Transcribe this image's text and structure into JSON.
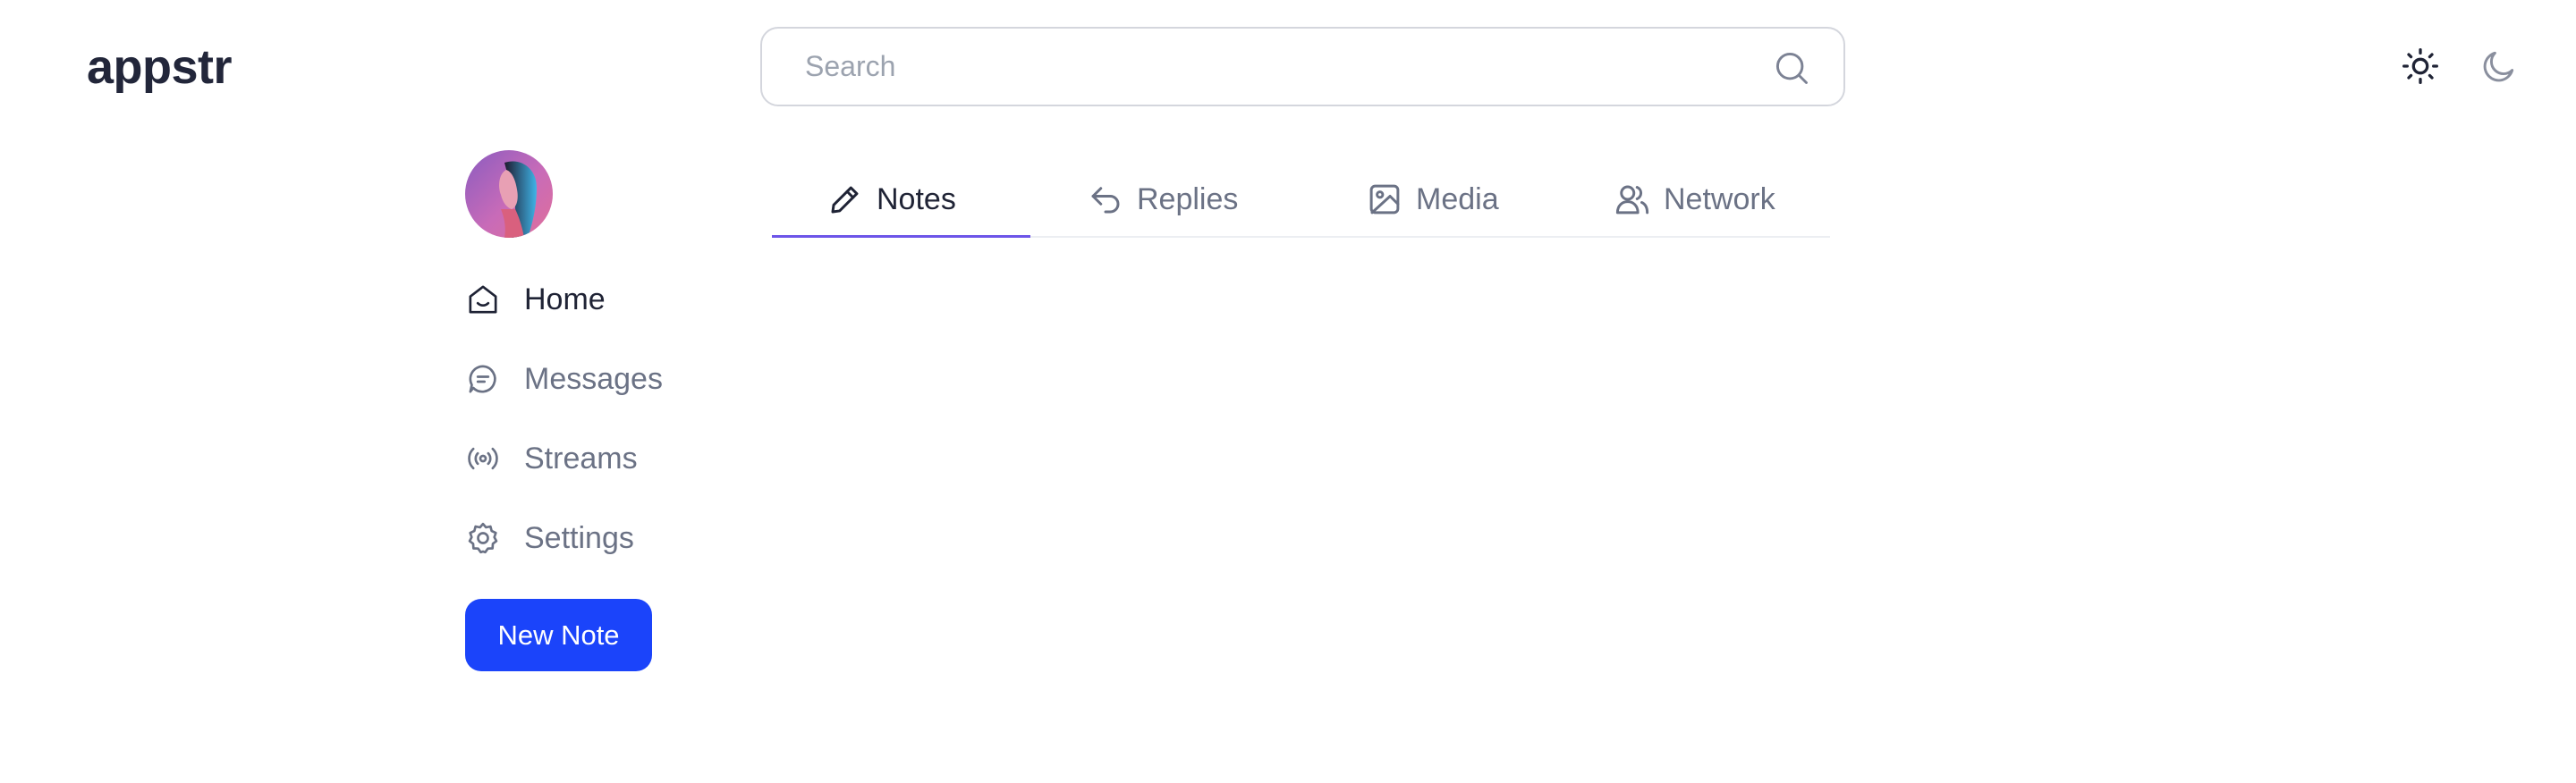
{
  "app": {
    "title": "appstr"
  },
  "search": {
    "placeholder": "Search",
    "value": ""
  },
  "theme": {
    "light_icon": "sun-icon",
    "dark_icon": "moon-icon"
  },
  "sidebar": {
    "items": [
      {
        "label": "Home",
        "icon": "home-icon",
        "active": true
      },
      {
        "label": "Messages",
        "icon": "message-icon",
        "active": false
      },
      {
        "label": "Streams",
        "icon": "broadcast-icon",
        "active": false
      },
      {
        "label": "Settings",
        "icon": "gear-icon",
        "active": false
      }
    ],
    "new_note_label": "New Note"
  },
  "tabs": [
    {
      "label": "Notes",
      "icon": "pencil-icon",
      "active": true
    },
    {
      "label": "Replies",
      "icon": "reply-icon",
      "active": false
    },
    {
      "label": "Media",
      "icon": "image-icon",
      "active": false
    },
    {
      "label": "Network",
      "icon": "users-icon",
      "active": false
    }
  ],
  "colors": {
    "accent": "#1b44fa",
    "tab_underline": "#6d55e8",
    "text_primary": "#1f2335",
    "text_muted": "#6b7285"
  }
}
